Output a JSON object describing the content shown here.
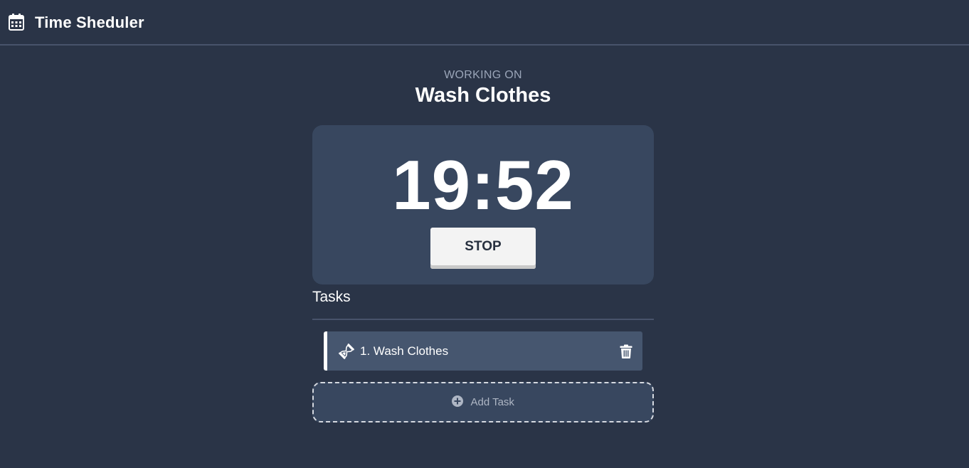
{
  "app": {
    "title": "Time Sheduler",
    "icon": "calendar-icon"
  },
  "current": {
    "label": "WORKING ON",
    "task": "Wash Clothes"
  },
  "timer": {
    "value": "19:52",
    "stop_label": "STOP"
  },
  "tasks": {
    "heading": "Tasks",
    "items": [
      {
        "label": "1. Wash Clothes",
        "status_icon": "hourglass-icon",
        "action_icon": "trash-icon"
      }
    ],
    "add_label": "Add Task",
    "add_icon": "plus-circle-icon"
  },
  "colors": {
    "background": "#2a3447",
    "card": "#38475f",
    "task_item": "#46566f",
    "button": "#f3f3f3",
    "muted_text": "#9aa5b8"
  }
}
